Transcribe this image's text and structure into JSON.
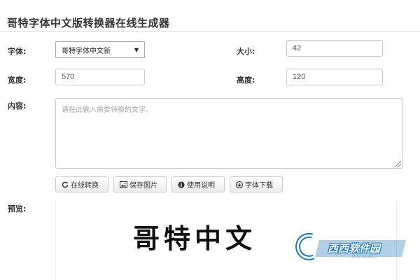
{
  "page": {
    "title": "哥特字体中文版转换器在线生成器"
  },
  "form": {
    "font_label": "字体:",
    "font_value": "哥特字体中文新",
    "size_label": "大小:",
    "size_value": "42",
    "width_label": "宽度:",
    "width_value": "570",
    "height_label": "高度:",
    "height_value": "120",
    "content_label": "内容:",
    "content_placeholder": "请在此输入需要转换的文字。",
    "preview_label": "预览:"
  },
  "buttons": {
    "convert": "在线转换",
    "save": "保存图片",
    "help": "使用说明",
    "download": "字体下载"
  },
  "preview": {
    "text": "哥特中文"
  },
  "watermark": {
    "brand": "西西软件园",
    "url": "CR173.COM"
  },
  "icons": {
    "convert": "refresh-icon",
    "save": "picture-icon",
    "help": "info-icon",
    "download": "download-icon"
  },
  "colors": {
    "border": "#cccccc",
    "watermark_blue": "#1a78b8"
  }
}
